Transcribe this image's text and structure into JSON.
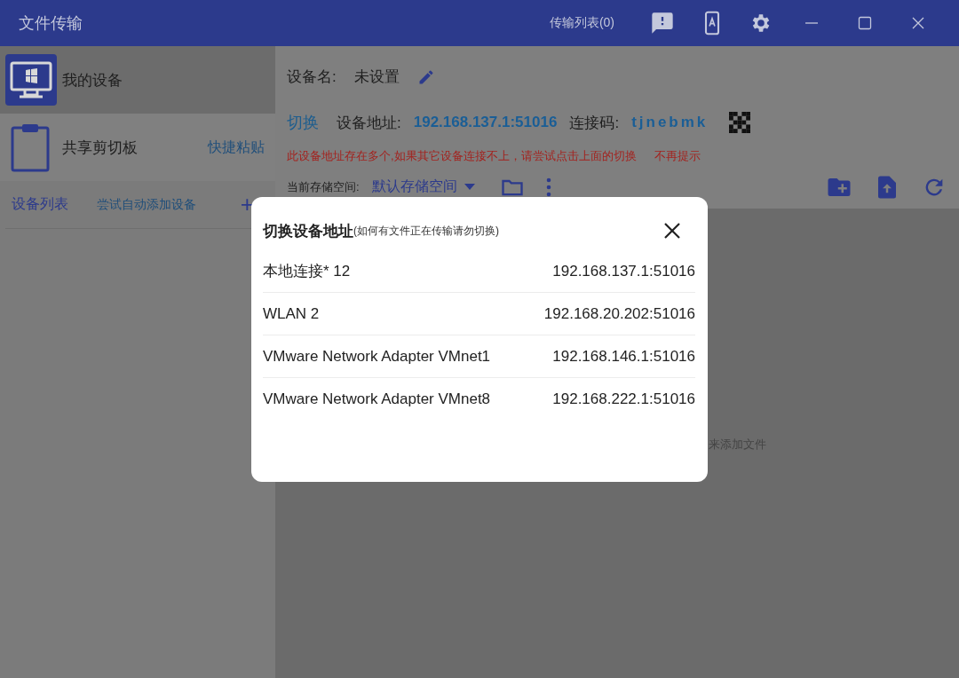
{
  "window": {
    "title": "文件传输",
    "transfer_list": "传输列表(0)"
  },
  "sidebar": {
    "items": [
      {
        "kind": "device",
        "label": "我的设备",
        "selected": true
      },
      {
        "kind": "clipboard",
        "label": "共享剪切板",
        "action": "快捷粘贴",
        "selected": false
      }
    ],
    "device_list": {
      "title": "设备列表",
      "auto_add": "尝试自动添加设备",
      "add": "+"
    }
  },
  "device": {
    "name_label": "设备名:",
    "name": "未设置",
    "switch": "切换",
    "address_label": "设备地址:",
    "address": "192.168.137.1:51016",
    "code_label": "连接码:",
    "code": "tjnebmk",
    "warning": "此设备地址存在多个,如果其它设备连接不上，请尝试点击上面的切换",
    "dismiss": "不再提示",
    "storage_label": "当前存储空间:",
    "storage": "默认存储空间"
  },
  "content": {
    "hint": "来添加文件"
  },
  "dialog": {
    "title": "切换设备地址",
    "note": "(如何有文件正在传输请勿切换)",
    "addresses": [
      {
        "name": "本地连接* 12",
        "address": "192.168.137.1:51016"
      },
      {
        "name": "WLAN 2",
        "address": "192.168.20.202:51016"
      },
      {
        "name": "VMware Network Adapter VMnet1",
        "address": "192.168.146.1:51016"
      },
      {
        "name": "VMware Network Adapter VMnet8",
        "address": "192.168.222.1:51016"
      }
    ]
  }
}
